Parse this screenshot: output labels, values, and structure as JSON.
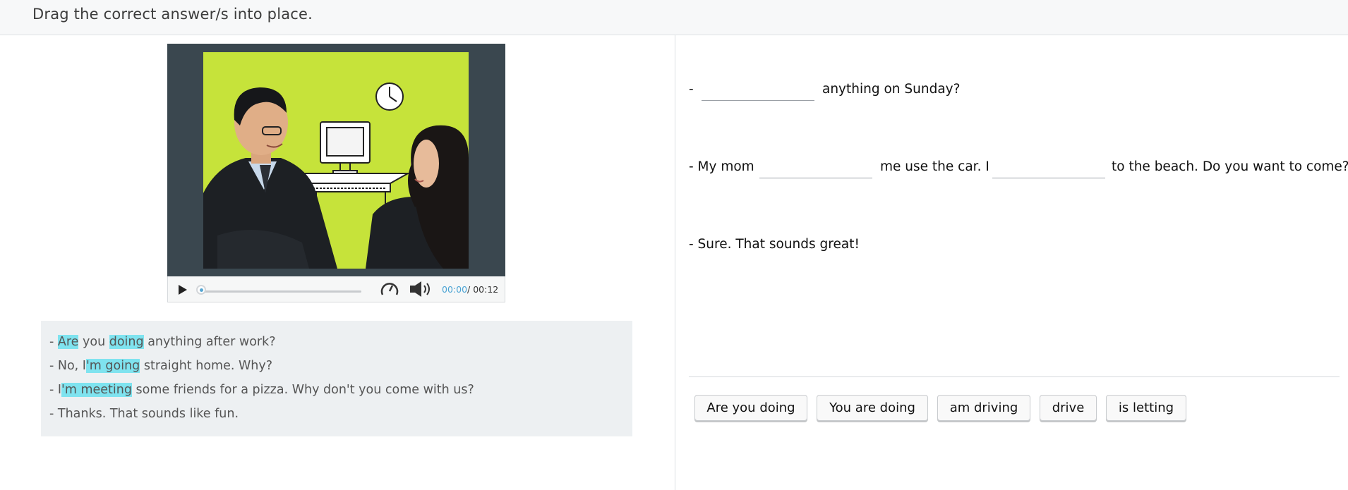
{
  "header": {
    "instruction": "Drag the correct answer/s into place."
  },
  "player": {
    "current_time": "00:00",
    "separator": "/",
    "duration": "00:12",
    "icons": [
      "play-icon",
      "speed-icon",
      "volume-icon"
    ]
  },
  "transcript": {
    "lines": [
      {
        "segments": [
          {
            "t": "- "
          },
          {
            "t": "Are",
            "hl": true
          },
          {
            "t": " you "
          },
          {
            "t": "doing",
            "hl": true
          },
          {
            "t": " anything after work?"
          }
        ]
      },
      {
        "segments": [
          {
            "t": "- No, I"
          },
          {
            "t": "'m going",
            "hl": true
          },
          {
            "t": " straight home. Why?"
          }
        ]
      },
      {
        "segments": [
          {
            "t": "- I"
          },
          {
            "t": "'m meeting",
            "hl": true
          },
          {
            "t": " some friends for a pizza. Why don't you come with us?"
          }
        ]
      },
      {
        "segments": [
          {
            "t": "- Thanks. That sounds like fun."
          }
        ]
      }
    ],
    "highlight_color": "#7fe3ef"
  },
  "exercise": {
    "q1": {
      "prefix": "-",
      "suffix": "anything on Sunday?"
    },
    "q2": {
      "prefix": "- My mom",
      "middle": "me use the car. I",
      "suffix": "to the beach. Do you want to come?"
    },
    "q3": {
      "text": "- Sure. That sounds great!"
    }
  },
  "answer_bank": [
    "Are you doing",
    "You are doing",
    "am driving",
    "drive",
    "is letting"
  ]
}
